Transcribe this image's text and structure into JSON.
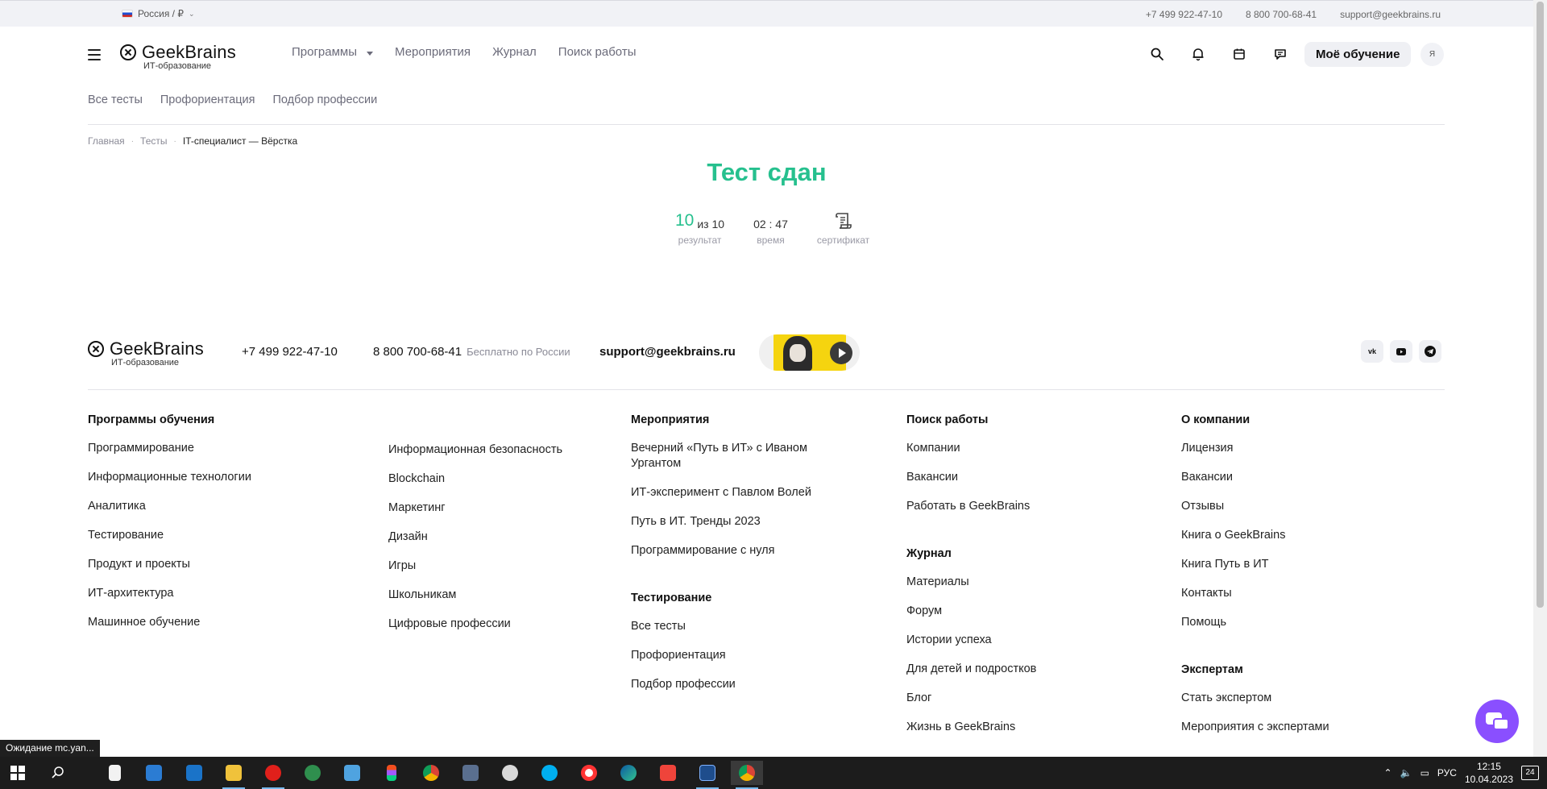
{
  "topbar": {
    "region": "Россия / ₽",
    "phone1": "+7 499 922-47-10",
    "phone2": "8 800 700-68-41",
    "email": "support@geekbrains.ru"
  },
  "header": {
    "logo_name": "GeekBrains",
    "logo_sub": "ИТ-образование",
    "nav": [
      "Программы",
      "Мероприятия",
      "Журнал",
      "Поиск работы"
    ],
    "my_learning": "Моё обучение",
    "avatar": "Я"
  },
  "subnav": [
    "Все тесты",
    "Профориентация",
    "Подбор профессии"
  ],
  "breadcrumbs": [
    "Главная",
    "Тесты",
    "IT-специалист — Вёрстка"
  ],
  "result": {
    "title": "Тест сдан",
    "score": "10",
    "score_of": "из 10",
    "score_label": "результат",
    "time": "02 : 47",
    "time_label": "время",
    "cert_label": "сертификат"
  },
  "footer": {
    "logo_name": "GeekBrains",
    "logo_sub": "ИТ-образование",
    "phone1": "+7 499 922-47-10",
    "phone2": "8 800 700-68-41",
    "phone2_note": "Бесплатно по России",
    "email": "support@geekbrains.ru",
    "socials": [
      "vk-icon",
      "youtube-icon",
      "telegram-icon"
    ],
    "programs_title": "Программы обучения",
    "programs_col1": [
      "Программирование",
      "Информационные технологии",
      "Аналитика",
      "Тестирование",
      "Продукт и проекты",
      "ИТ-архитектура",
      "Машинное обучение"
    ],
    "programs_col2": [
      "Информационная безопасность",
      "Blockchain",
      "Маркетинг",
      "Дизайн",
      "Игры",
      "Школьникам",
      "Цифровые профессии"
    ],
    "events_title": "Мероприятия",
    "events": [
      "Вечерний «Путь в ИТ» с Иваном Ургантом",
      "ИТ-эксперимент с Павлом Волей",
      "Путь в ИТ. Тренды 2023",
      "Программирование с нуля"
    ],
    "testing_title": "Тестирование",
    "testing": [
      "Все тесты",
      "Профориентация",
      "Подбор профессии"
    ],
    "jobs_title": "Поиск работы",
    "jobs": [
      "Компании",
      "Вакансии",
      "Работать в GeekBrains"
    ],
    "journal_title": "Журнал",
    "journal": [
      "Материалы",
      "Форум",
      "Истории успеха",
      "Для детей и подростков",
      "Блог",
      "Жизнь в GeekBrains"
    ],
    "about_title": "О компании",
    "about": [
      "Лицензия",
      "Вакансии",
      "Отзывы",
      "Книга о GeekBrains",
      "Книга Путь в ИТ",
      "Контакты",
      "Помощь"
    ],
    "experts_title": "Экспертам",
    "experts": [
      "Стать экспертом",
      "Мероприятия с экспертами"
    ]
  },
  "status_tooltip": "Ожидание mc.yan...",
  "taskbar": {
    "lang": "РУС",
    "time": "12:15",
    "date": "10.04.2023",
    "notifications": "24"
  },
  "colors": {
    "accent_green": "#26c08e",
    "chat_purple": "#8a4fff"
  }
}
